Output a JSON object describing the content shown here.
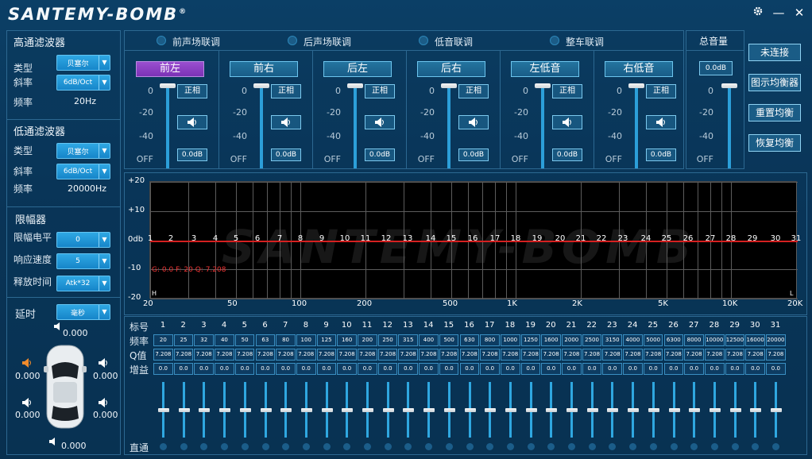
{
  "app": {
    "title": "SANTEMY-BOMB",
    "reg": "®"
  },
  "window": {
    "settings_icon": "gear-icon",
    "minimize": "—",
    "close": "✕"
  },
  "left": {
    "hp": {
      "title": "高通滤波器",
      "type_label": "类型",
      "type_value": "贝塞尔",
      "slope_label": "斜率",
      "slope_value": "6dB/Oct",
      "freq_label": "频率",
      "freq_value": "20Hz"
    },
    "lp": {
      "title": "低通滤波器",
      "type_label": "类型",
      "type_value": "贝塞尔",
      "slope_label": "斜率",
      "slope_value": "6dB/Oct",
      "freq_label": "频率",
      "freq_value": "20000Hz"
    },
    "limiter": {
      "title": "限幅器",
      "level_label": "限幅电平",
      "level_value": "0",
      "speed_label": "响应速度",
      "speed_value": "5",
      "release_label": "释放时间",
      "release_value": "Atk*32"
    },
    "delay": {
      "label": "延时",
      "unit": "毫秒"
    },
    "car": {
      "top": "0.000",
      "fl": "0.000",
      "fr": "0.000",
      "rl": "0.000",
      "rr": "0.000",
      "bottom": "0.000"
    }
  },
  "links": [
    "前声场联调",
    "后声场联调",
    "低音联调",
    "整车联调"
  ],
  "channels": [
    {
      "name": "前左",
      "phase": "正相",
      "db": "0.0dB"
    },
    {
      "name": "前右",
      "phase": "正相",
      "db": "0.0dB"
    },
    {
      "name": "后左",
      "phase": "正相",
      "db": "0.0dB"
    },
    {
      "name": "后右",
      "phase": "正相",
      "db": "0.0dB"
    },
    {
      "name": "左低音",
      "phase": "正相",
      "db": "0.0dB"
    },
    {
      "name": "右低音",
      "phase": "正相",
      "db": "0.0dB"
    }
  ],
  "fader_ticks": [
    "0",
    "-20",
    "-40",
    "OFF"
  ],
  "master": {
    "title": "总音量",
    "db": "0.0dB"
  },
  "side_buttons": [
    "未连接",
    "图示均衡器",
    "重置均衡",
    "恢复均衡"
  ],
  "graph": {
    "y_ticks": [
      "+20",
      "+10",
      "0db",
      "-10",
      "-20"
    ],
    "x_ticks": [
      "20",
      "50",
      "100",
      "200",
      "500",
      "1K",
      "2K",
      "5K",
      "10K",
      "20K"
    ],
    "info": "G: 0.0  F: 20  Q: 7.208",
    "watermark": "SANTEMY-BOMB",
    "h_label": "H",
    "l_label": "L",
    "band_numbers": [
      "1",
      "2",
      "3",
      "4",
      "5",
      "6",
      "7",
      "8",
      "9",
      "10",
      "11",
      "12",
      "13",
      "14",
      "15",
      "16",
      "17",
      "18",
      "19",
      "20",
      "21",
      "22",
      "23",
      "24",
      "25",
      "26",
      "27",
      "28",
      "29",
      "30",
      "31"
    ]
  },
  "eq": {
    "row_labels": {
      "num": "标号",
      "freq": "频率",
      "q": "Q值",
      "gain": "增益",
      "bypass": "直通"
    },
    "freqs": [
      "20",
      "25",
      "32",
      "40",
      "50",
      "63",
      "80",
      "100",
      "125",
      "160",
      "200",
      "250",
      "315",
      "400",
      "500",
      "630",
      "800",
      "1000",
      "1250",
      "1600",
      "2000",
      "2500",
      "3150",
      "4000",
      "5000",
      "6300",
      "8000",
      "10000",
      "12500",
      "16000",
      "20000"
    ],
    "q": "7.208",
    "gain": "0.0"
  },
  "colors": {
    "accent": "#2c9fd9",
    "selected": "#8a3fc4",
    "eq_line": "#d42020"
  }
}
